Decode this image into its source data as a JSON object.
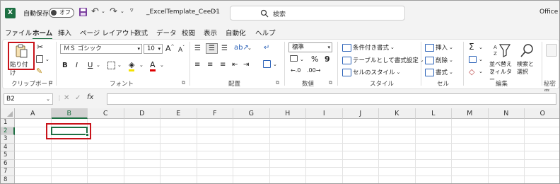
{
  "titlebar": {
    "logo": "X",
    "autosave_label": "自動保存",
    "autosave_state": "オフ",
    "filename": "_ExcelTemplate_CeeD1",
    "filename_more": "···",
    "search_placeholder": "検索",
    "app_name": "Office",
    "undo_icon": "undo-icon",
    "redo_icon": "redo-icon"
  },
  "menu": [
    "ファイル",
    "ホーム",
    "挿入",
    "ページ レイアウト",
    "数式",
    "データ",
    "校閲",
    "表示",
    "自動化",
    "ヘルプ"
  ],
  "ribbon": {
    "clipboard": {
      "paste": "貼り付け",
      "label": "クリップボード"
    },
    "font": {
      "name": "ＭＳ ゴシック",
      "size": "10",
      "grow": "A",
      "shrink": "A",
      "bold": "B",
      "italic": "I",
      "underline": "U",
      "label": "フォント"
    },
    "alignment": {
      "label": "配置"
    },
    "number": {
      "format": "標準",
      "percent": "%",
      "comma": "9",
      "label": "数値"
    },
    "styles": {
      "conditional": "条件付き書式",
      "table": "テーブルとして書式設定",
      "cell": "セルのスタイル",
      "label": "スタイル"
    },
    "cells": {
      "insert": "挿入",
      "delete": "削除",
      "format": "書式",
      "label": "セル"
    },
    "editing": {
      "sum": "Σ",
      "sort_line1": "並べ替えと",
      "sort_line2": "フィルター",
      "find_line1": "検索と",
      "find_line2": "選択",
      "label": "編集"
    },
    "sensitivity": {
      "label": "秘密度"
    }
  },
  "formula_bar": {
    "namebox": "B2",
    "fx": "fx",
    "cancel": "✕",
    "enter": "✓",
    "value": ""
  },
  "sheet": {
    "columns": [
      "A",
      "B",
      "C",
      "D",
      "E",
      "F",
      "G",
      "H",
      "I",
      "J",
      "K",
      "L",
      "M",
      "N",
      "O"
    ],
    "rows": [
      "1",
      "2",
      "3",
      "4",
      "5",
      "6",
      "7",
      "8"
    ],
    "selected_cell": "B2"
  },
  "colors": {
    "excel_green": "#1d6f42",
    "highlight_red": "#c8131a"
  }
}
